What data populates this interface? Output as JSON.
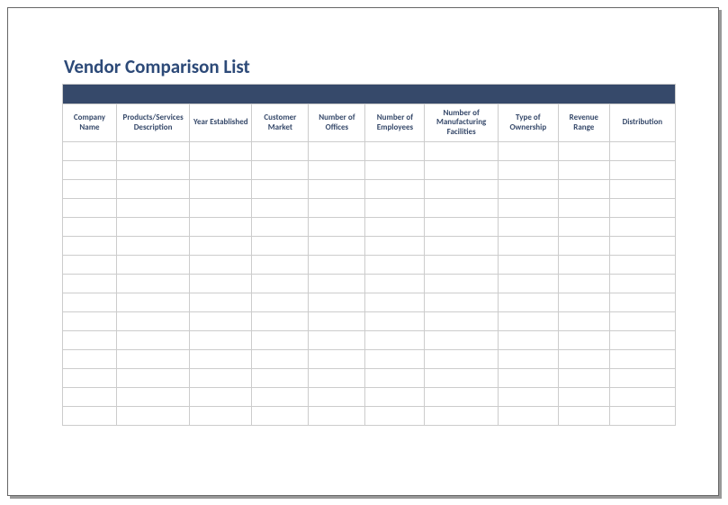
{
  "title": "Vendor Comparison List",
  "columns": [
    "Company Name",
    "Products/Services Description",
    "Year Established",
    "Customer Market",
    "Number of Offices",
    "Number of Employees",
    "Number of Manufacturing Facilities",
    "Type of Ownership",
    "Revenue Range",
    "Distribution"
  ],
  "rows": [
    [
      "",
      "",
      "",
      "",
      "",
      "",
      "",
      "",
      "",
      ""
    ],
    [
      "",
      "",
      "",
      "",
      "",
      "",
      "",
      "",
      "",
      ""
    ],
    [
      "",
      "",
      "",
      "",
      "",
      "",
      "",
      "",
      "",
      ""
    ],
    [
      "",
      "",
      "",
      "",
      "",
      "",
      "",
      "",
      "",
      ""
    ],
    [
      "",
      "",
      "",
      "",
      "",
      "",
      "",
      "",
      "",
      ""
    ],
    [
      "",
      "",
      "",
      "",
      "",
      "",
      "",
      "",
      "",
      ""
    ],
    [
      "",
      "",
      "",
      "",
      "",
      "",
      "",
      "",
      "",
      ""
    ],
    [
      "",
      "",
      "",
      "",
      "",
      "",
      "",
      "",
      "",
      ""
    ],
    [
      "",
      "",
      "",
      "",
      "",
      "",
      "",
      "",
      "",
      ""
    ],
    [
      "",
      "",
      "",
      "",
      "",
      "",
      "",
      "",
      "",
      ""
    ],
    [
      "",
      "",
      "",
      "",
      "",
      "",
      "",
      "",
      "",
      ""
    ],
    [
      "",
      "",
      "",
      "",
      "",
      "",
      "",
      "",
      "",
      ""
    ],
    [
      "",
      "",
      "",
      "",
      "",
      "",
      "",
      "",
      "",
      ""
    ],
    [
      "",
      "",
      "",
      "",
      "",
      "",
      "",
      "",
      "",
      ""
    ],
    [
      "",
      "",
      "",
      "",
      "",
      "",
      "",
      "",
      "",
      ""
    ]
  ]
}
